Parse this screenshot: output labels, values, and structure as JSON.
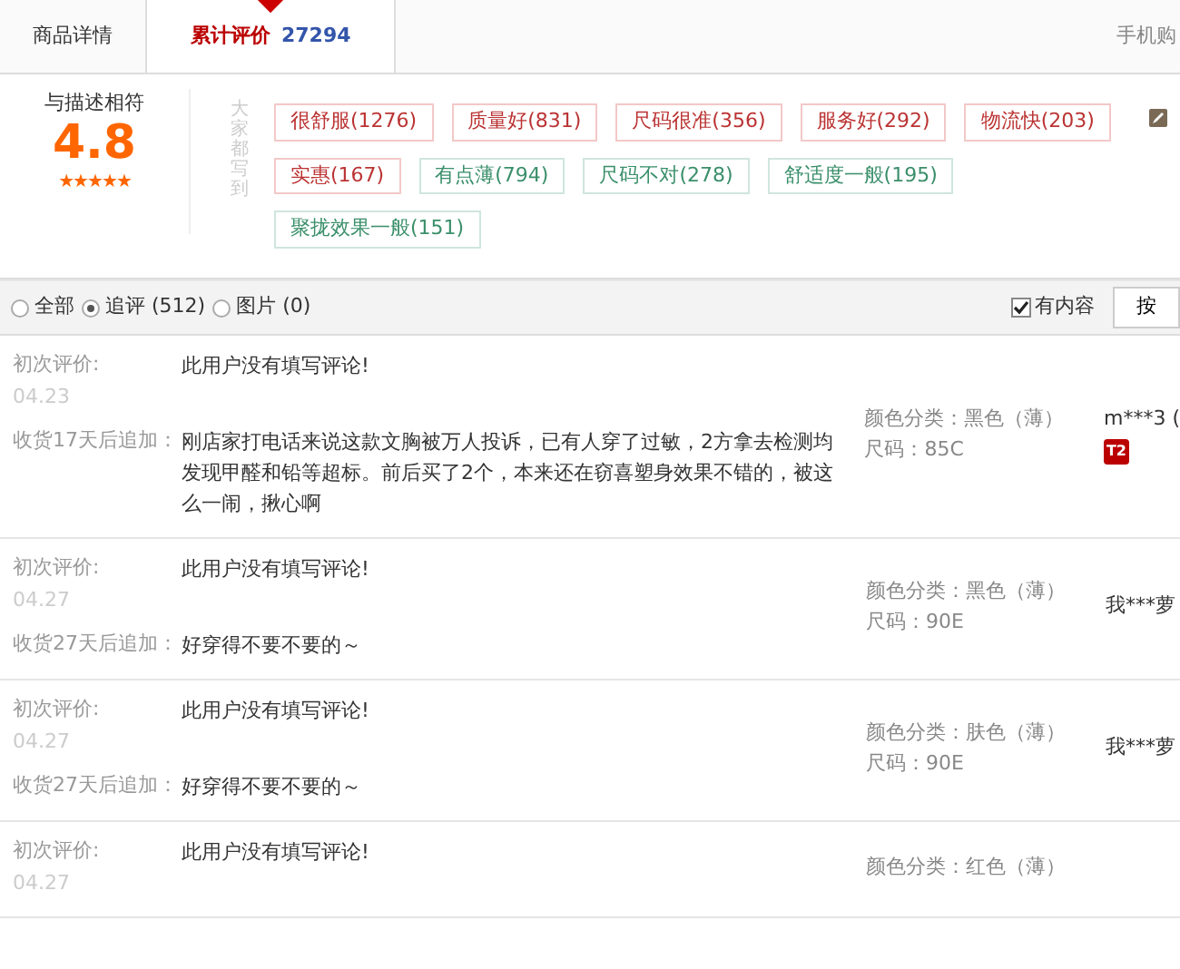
{
  "tabs": [
    {
      "label": "商品详情",
      "selected": false
    },
    {
      "label": "累计评价",
      "count": "27294",
      "selected": true
    }
  ],
  "mobile_link": "手机购",
  "summary": {
    "label": "与描述相符",
    "score": "4.8",
    "stars": 5,
    "tags_heading": "大家都写到",
    "tags": [
      {
        "text": "很舒服(1276)",
        "kind": "positive"
      },
      {
        "text": "质量好(831)",
        "kind": "positive"
      },
      {
        "text": "尺码很准(356)",
        "kind": "positive"
      },
      {
        "text": "服务好(292)",
        "kind": "positive"
      },
      {
        "text": "物流快(203)",
        "kind": "positive"
      },
      {
        "text": "实惠(167)",
        "kind": "positive"
      },
      {
        "text": "有点薄(794)",
        "kind": "negative"
      },
      {
        "text": "尺码不对(278)",
        "kind": "negative"
      },
      {
        "text": "舒适度一般(195)",
        "kind": "negative"
      },
      {
        "text": "聚拢效果一般(151)",
        "kind": "negative"
      }
    ]
  },
  "filters": {
    "options": [
      {
        "label": "全部",
        "selected": false
      },
      {
        "label": "追评 (512)",
        "selected": true
      },
      {
        "label": "图片 (0)",
        "selected": false
      }
    ],
    "has_content": {
      "label": "有内容",
      "checked": true
    },
    "sort_button": "按"
  },
  "reviews": [
    {
      "first_label": "初次评价:",
      "first_text": "此用户没有填写评论!",
      "date": "04.23",
      "append_label": "收货17天后追加：",
      "append_text": "刚店家打电话来说这款文胸被万人投诉，已有人穿了过敏，2方拿去检测均发现甲醛和铅等超标。前后买了2个，本来还在窃喜塑身效果不错的，被这么一闹，揪心啊",
      "sku": [
        "颜色分类：黑色（薄）",
        "尺码：85C"
      ],
      "user": "m***3 (",
      "badge": "T2"
    },
    {
      "first_label": "初次评价:",
      "first_text": "此用户没有填写评论!",
      "date": "04.27",
      "append_label": "收货27天后追加：",
      "append_text": "好穿得不要不要的～",
      "sku": [
        "颜色分类：黑色（薄）",
        "尺码：90E"
      ],
      "user": "我***萝"
    },
    {
      "first_label": "初次评价:",
      "first_text": "此用户没有填写评论!",
      "date": "04.27",
      "append_label": "收货27天后追加：",
      "append_text": "好穿得不要不要的～",
      "sku": [
        "颜色分类：肤色（薄）",
        "尺码：90E"
      ],
      "user": "我***萝"
    },
    {
      "first_label": "初次评价:",
      "first_text": "此用户没有填写评论!",
      "date": "04.27",
      "sku": [
        "颜色分类：红色（薄）"
      ]
    }
  ]
}
